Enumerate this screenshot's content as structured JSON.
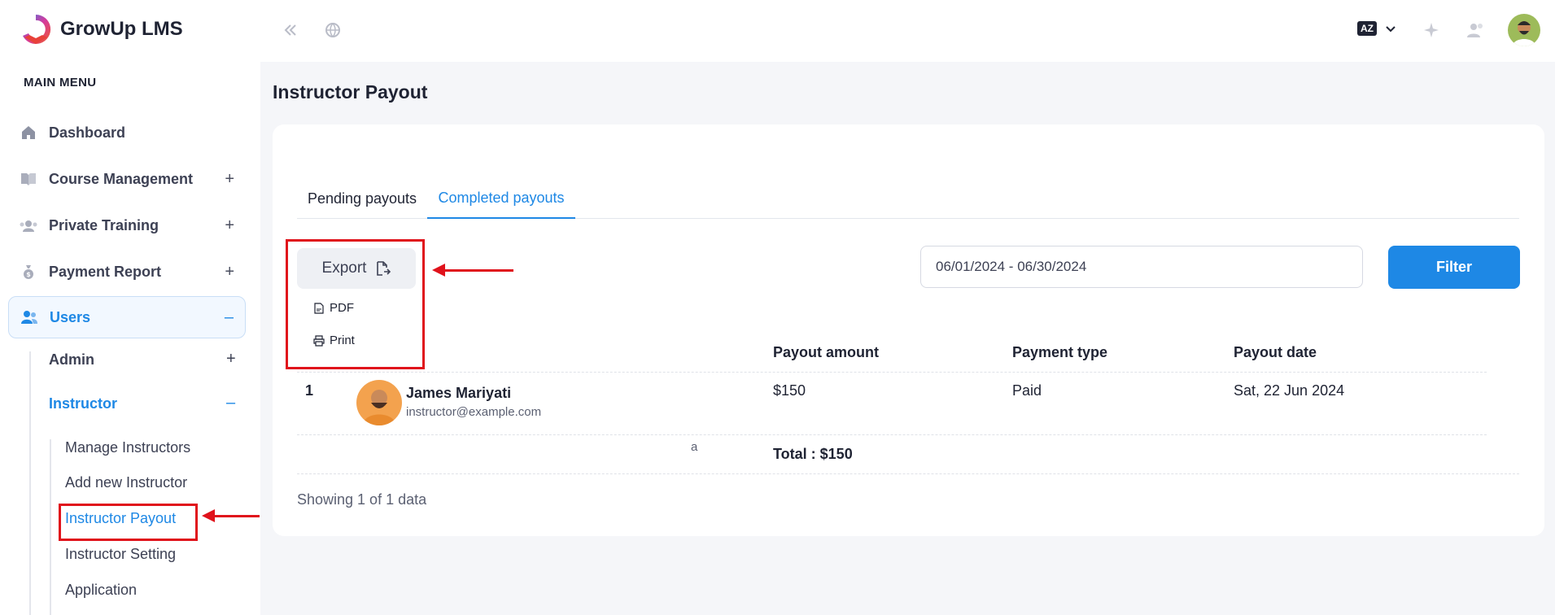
{
  "app": {
    "brand": "GrowUp LMS",
    "lang_badge": "AZ"
  },
  "sidebar": {
    "heading": "MAIN MENU",
    "items": [
      {
        "label": "Dashboard",
        "icon": "home-icon"
      },
      {
        "label": "Course Management",
        "icon": "book-icon",
        "toggle": "+"
      },
      {
        "label": "Private Training",
        "icon": "people-icon",
        "toggle": "+"
      },
      {
        "label": "Payment Report",
        "icon": "money-bag-icon",
        "toggle": "+"
      },
      {
        "label": "Users",
        "icon": "users-icon",
        "toggle": "–"
      }
    ],
    "users_sub": [
      {
        "label": "Admin",
        "toggle": "+"
      },
      {
        "label": "Instructor",
        "toggle": "–"
      }
    ],
    "instructor_sub": [
      "Manage Instructors",
      "Add new Instructor",
      "Instructor Payout",
      "Instructor Setting",
      "Application"
    ]
  },
  "page": {
    "title": "Instructor Payout",
    "tabs": [
      "Pending payouts",
      "Completed payouts"
    ],
    "export_label": "Export",
    "export_menu": [
      "PDF",
      "Print"
    ],
    "date_range": "06/01/2024 - 06/30/2024",
    "filter_label": "Filter",
    "stray_char": "a",
    "table": {
      "headers": [
        "Payout amount",
        "Payment type",
        "Payout date"
      ],
      "rows": [
        {
          "index": "1",
          "name": "James Mariyati",
          "email": "instructor@example.com",
          "amount": "$150",
          "type": "Paid",
          "date": "Sat, 22 Jun 2024"
        }
      ],
      "total": "Total : $150"
    },
    "showing": "Showing 1 of 1 data"
  },
  "colors": {
    "accent": "#1e88e5",
    "annotation": "#e0121b"
  }
}
